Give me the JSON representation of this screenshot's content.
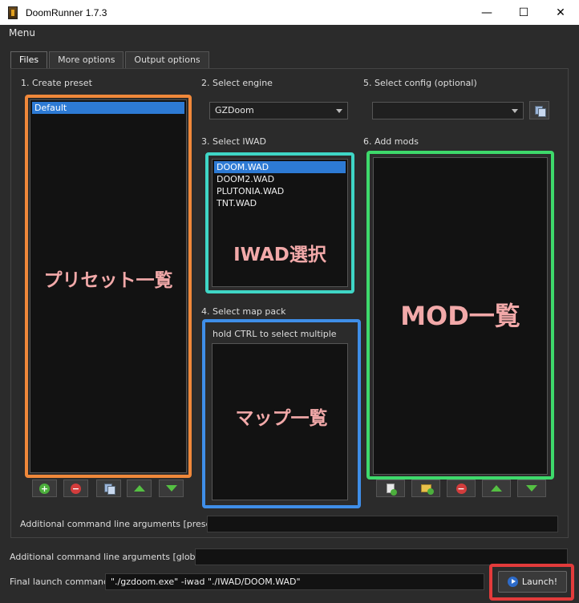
{
  "window": {
    "title": "DoomRunner 1.7.3",
    "minimize": "—",
    "maximize": "☐",
    "close": "✕"
  },
  "menu": {
    "label": "Menu"
  },
  "tabs": [
    {
      "label": "Files",
      "active": true
    },
    {
      "label": "More options",
      "active": false
    },
    {
      "label": "Output options",
      "active": false
    }
  ],
  "preset": {
    "heading": "1. Create preset",
    "items": [
      "Default"
    ],
    "selected": "Default",
    "overlay": "プリセット一覧"
  },
  "engine": {
    "heading": "2. Select engine",
    "value": "GZDoom"
  },
  "iwad": {
    "heading": "3. Select IWAD",
    "items": [
      "DOOM.WAD",
      "DOOM2.WAD",
      "PLUTONIA.WAD",
      "TNT.WAD"
    ],
    "selected": "DOOM.WAD",
    "overlay": "IWAD選択"
  },
  "mappack": {
    "heading": "4. Select map pack",
    "hint": "hold CTRL to select multiple",
    "overlay": "マップ一覧"
  },
  "config": {
    "heading": "5. Select config (optional)",
    "value": ""
  },
  "mods": {
    "heading": "6. Add mods",
    "overlay": "MOD一覧"
  },
  "args": {
    "preset_label": "Additional command line arguments [preset]",
    "preset_value": "",
    "global_label": "Additional command line arguments [global]",
    "global_value": "",
    "final_label": "Final launch command",
    "final_value": "\"./gzdoom.exe\" -iwad \"./IWAD/DOOM.WAD\""
  },
  "launch": {
    "label": "Launch!"
  },
  "colors": {
    "orange": "#f0883a",
    "cyan": "#3fd6c6",
    "blue": "#3f8ee8",
    "green": "#3ed96b",
    "red": "#e33b3b",
    "overlay_text": "#f2a9a9",
    "selection": "#2d7ad4"
  }
}
